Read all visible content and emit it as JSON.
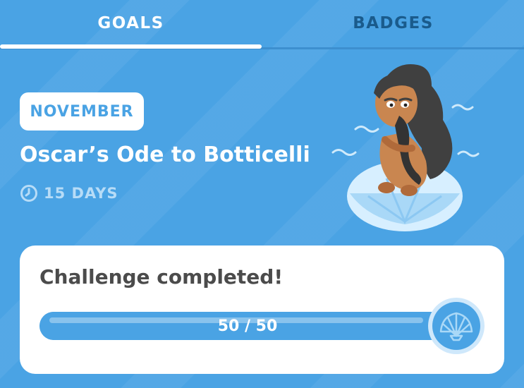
{
  "tabs": [
    {
      "label": "GOALS",
      "active": true
    },
    {
      "label": "BADGES",
      "active": false
    }
  ],
  "challenge": {
    "month": "NOVEMBER",
    "title": "Oscar’s Ode to Botticelli",
    "duration": "15 DAYS",
    "duration_icon": "clock-icon"
  },
  "progress": {
    "heading": "Challenge completed!",
    "label": "50 / 50",
    "current": 50,
    "total": 50,
    "completion_icon": "shell-icon"
  },
  "colors": {
    "background": "#4aa3e4",
    "tab_active": "#ffffff",
    "tab_inactive": "#1a5b8c",
    "progress_track": "#3e96da",
    "card": "#ffffff",
    "heading_text": "#4b4b4b"
  }
}
